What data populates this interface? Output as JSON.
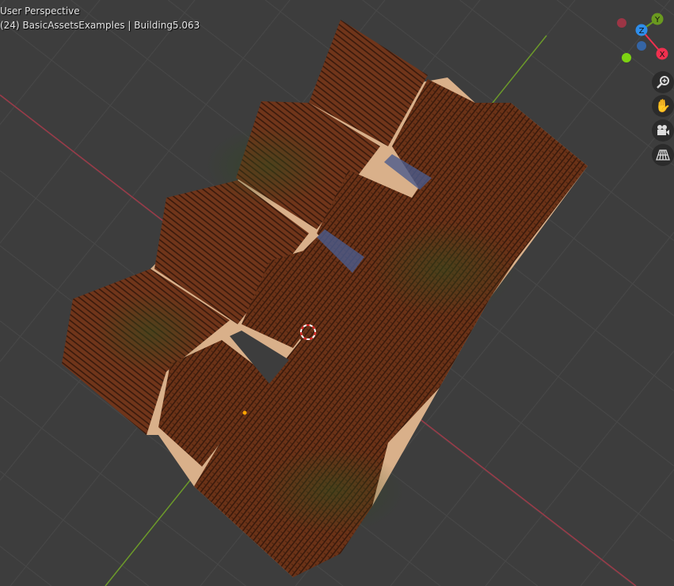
{
  "viewport": {
    "view_name": "User Perspective",
    "collection_info": "(24) BasicAssetsExamples | Building5.063"
  },
  "gizmo": {
    "axes": [
      {
        "label": "X",
        "color": "#f0304f"
      },
      {
        "label": "Y",
        "color": "#6a9a1f"
      },
      {
        "label": "Z",
        "color": "#2e8dea"
      }
    ],
    "negative_x_color": "#9c3545",
    "negative_y_color": "#7dd312",
    "negative_z_color": "#3565a5"
  },
  "nav_buttons": [
    {
      "icon": "zoom-icon"
    },
    {
      "icon": "hand-pan-icon"
    },
    {
      "icon": "camera-icon"
    },
    {
      "icon": "perspective-grid-icon"
    }
  ],
  "colors": {
    "background": "#3d3d3d",
    "grid": "#4a4a4a",
    "x_axis": "#9c3a48",
    "y_axis": "#6c9a2a",
    "roof": "#6b3217",
    "wall": "#d9b08a"
  }
}
